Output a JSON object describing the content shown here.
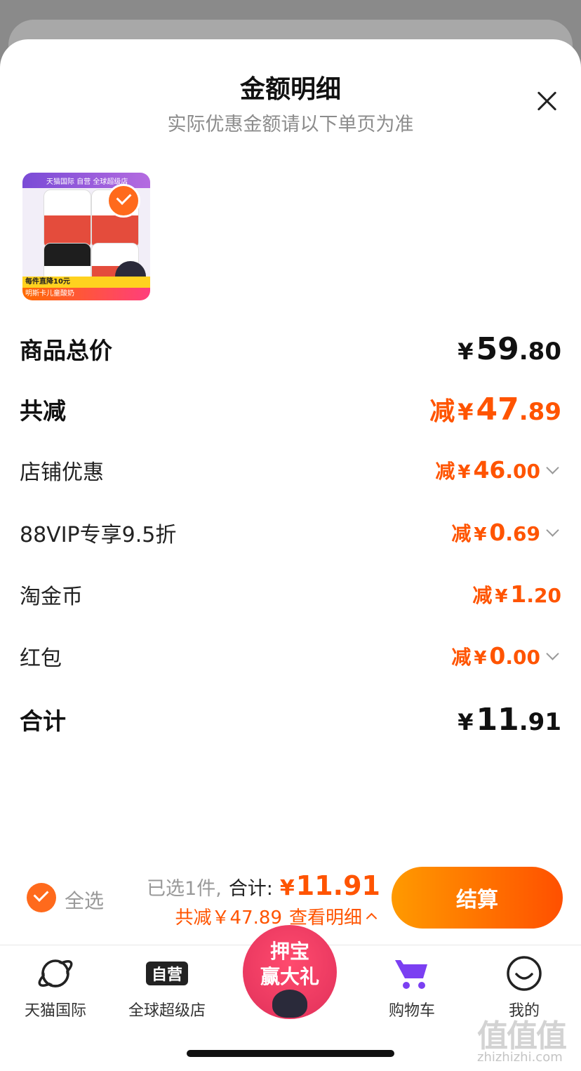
{
  "header": {
    "title": "金额明细",
    "subtitle": "实际优惠金额请以下单页为准"
  },
  "product": {
    "thumb_top_text": "天猫国际 自营 全球超级店",
    "thumb_band_text": "每件直降10元",
    "thumb_name_text": "明斯卡儿童酸奶",
    "selected": true
  },
  "rows": {
    "total_price": {
      "label": "商品总价",
      "yen": "¥",
      "int": "59",
      "dec": ".80"
    },
    "total_discount": {
      "label": "共减",
      "prefix": "减",
      "yen": "¥",
      "int": "47",
      "dec": ".89"
    },
    "shop_discount": {
      "label": "店铺优惠",
      "prefix": "减",
      "yen": "¥",
      "int": "46",
      "dec": ".00"
    },
    "vip_discount": {
      "label": "88VIP专享9.5折",
      "prefix": "减",
      "yen": "¥",
      "int": "0",
      "dec": ".69"
    },
    "coins": {
      "label": "淘金币",
      "prefix": "减",
      "yen": "¥",
      "int": "1",
      "dec": ".20"
    },
    "red_packet": {
      "label": "红包",
      "prefix": "减",
      "yen": "¥",
      "int": "0",
      "dec": ".00"
    },
    "grand_total": {
      "label": "合计",
      "yen": "¥",
      "int": "11",
      "dec": ".91"
    }
  },
  "footer": {
    "select_all": "全选",
    "selected_count": "已选1件,",
    "total_label": "合计:",
    "total_yen": "¥",
    "total_amount": "11.91",
    "discount_summary": "共减￥47.89",
    "detail_link": "查看明细",
    "checkout_label": "结算"
  },
  "tabs": [
    {
      "label": "天猫国际",
      "icon": "planet-icon"
    },
    {
      "label": "全球超级店",
      "icon": "ziying-icon"
    },
    {
      "label": "押宝赢大礼",
      "icon": "promo-icon"
    },
    {
      "label": "购物车",
      "icon": "cart-icon"
    },
    {
      "label": "我的",
      "icon": "smile-icon"
    }
  ],
  "promo": {
    "line1": "押宝",
    "line2": "赢大礼"
  },
  "watermark": {
    "main": "值值值",
    "sub": "zhizhizhi.com"
  },
  "colors": {
    "accent": "#ff5400",
    "checkout_from": "#ff9a00",
    "checkout_to": "#ff5000",
    "cart": "#7b3ff2"
  }
}
